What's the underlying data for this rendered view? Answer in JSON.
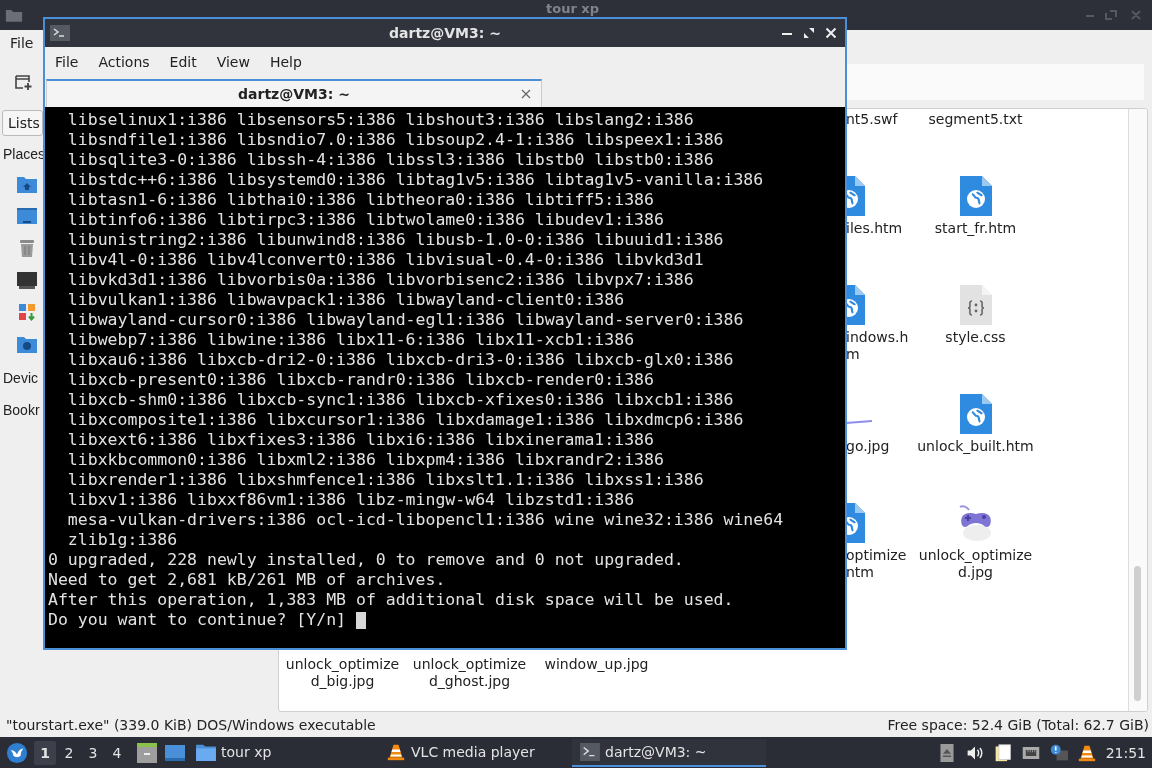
{
  "file_manager": {
    "title": "tour xp",
    "menu": [
      "File"
    ],
    "sidebar": {
      "tab": "Lists",
      "sections": [
        {
          "label": "Places",
          "items": [
            {
              "kind": "home"
            },
            {
              "kind": "desktop"
            },
            {
              "kind": "trash"
            },
            {
              "kind": "computer"
            },
            {
              "kind": "apps"
            },
            {
              "kind": "network"
            }
          ]
        },
        {
          "label": "Devic"
        },
        {
          "label": "Bookr"
        }
      ]
    },
    "files_partial": [
      {
        "label_lines": [
          "nt5.swf"
        ]
      },
      {
        "kind": "web",
        "label_lines": [
          "iles.htm"
        ]
      },
      {
        "kind": "web",
        "label_lines": [
          "indows.h",
          "m"
        ]
      },
      {
        "kind": "image",
        "label_lines": [
          "go.jpg"
        ]
      },
      {
        "kind": "web",
        "label_lines": [
          "optimize",
          "ntm"
        ]
      }
    ],
    "files_full": [
      {
        "label_lines": [
          "segment5.txt"
        ]
      },
      {
        "kind": "web",
        "label_lines": [
          "start_fr.htm"
        ]
      },
      {
        "kind": "css",
        "label_lines": [
          "style.css"
        ]
      },
      {
        "kind": "web",
        "label_lines": [
          "unlock_built.htm"
        ]
      },
      {
        "kind": "gamepad",
        "label_lines": [
          "unlock_optimize",
          "d.jpg"
        ]
      }
    ],
    "files_bottom": [
      {
        "label_lines": [
          "unlock_optimize",
          "d_big.jpg"
        ]
      },
      {
        "label_lines": [
          "unlock_optimize",
          "d_ghost.jpg"
        ]
      },
      {
        "label_lines": [
          "window_up.jpg"
        ]
      }
    ],
    "status_left": "\"tourstart.exe\" (339.0 KiB) DOS/Windows executable",
    "status_right": "Free space: 52.4 GiB (Total: 62.7 GiB)"
  },
  "terminal": {
    "title": "dartz@VM3: ~",
    "menu": [
      "File",
      "Actions",
      "Edit",
      "View",
      "Help"
    ],
    "tabs": [
      {
        "title": "dartz@VM3: ~",
        "selected": true
      }
    ],
    "lines": [
      "  libselinux1:i386 libsensors5:i386 libshout3:i386 libslang2:i386",
      "  libsndfile1:i386 libsndio7.0:i386 libsoup2.4-1:i386 libspeex1:i386",
      "  libsqlite3-0:i386 libssh-4:i386 libssl3:i386 libstb0 libstb0:i386",
      "  libstdc++6:i386 libsystemd0:i386 libtag1v5:i386 libtag1v5-vanilla:i386",
      "  libtasn1-6:i386 libthai0:i386 libtheora0:i386 libtiff5:i386",
      "  libtinfo6:i386 libtirpc3:i386 libtwolame0:i386 libudev1:i386",
      "  libunistring2:i386 libunwind8:i386 libusb-1.0-0:i386 libuuid1:i386",
      "  libv4l-0:i386 libv4lconvert0:i386 libvisual-0.4-0:i386 libvkd3d1",
      "  libvkd3d1:i386 libvorbis0a:i386 libvorbisenc2:i386 libvpx7:i386",
      "  libvulkan1:i386 libwavpack1:i386 libwayland-client0:i386",
      "  libwayland-cursor0:i386 libwayland-egl1:i386 libwayland-server0:i386",
      "  libwebp7:i386 libwine:i386 libx11-6:i386 libx11-xcb1:i386",
      "  libxau6:i386 libxcb-dri2-0:i386 libxcb-dri3-0:i386 libxcb-glx0:i386",
      "  libxcb-present0:i386 libxcb-randr0:i386 libxcb-render0:i386",
      "  libxcb-shm0:i386 libxcb-sync1:i386 libxcb-xfixes0:i386 libxcb1:i386",
      "  libxcomposite1:i386 libxcursor1:i386 libxdamage1:i386 libxdmcp6:i386",
      "  libxext6:i386 libxfixes3:i386 libxi6:i386 libxinerama1:i386",
      "  libxkbcommon0:i386 libxml2:i386 libxpm4:i386 libxrandr2:i386",
      "  libxrender1:i386 libxshmfence1:i386 libxslt1.1:i386 libxss1:i386",
      "  libxv1:i386 libxxf86vm1:i386 libz-mingw-w64 libzstd1:i386",
      "  mesa-vulkan-drivers:i386 ocl-icd-libopencl1:i386 wine wine32:i386 wine64",
      "  zlib1g:i386",
      "0 upgraded, 228 newly installed, 0 to remove and 0 not upgraded.",
      "Need to get 2,681 kB/261 MB of archives.",
      "After this operation, 1,383 MB of additional disk space will be used.",
      "Do you want to continue? [Y/n]"
    ],
    "cursor": true
  },
  "taskbar": {
    "workspaces": [
      {
        "label": "1",
        "selected": true
      },
      {
        "label": "2",
        "selected": false
      },
      {
        "label": "3",
        "selected": false
      },
      {
        "label": "4",
        "selected": false
      }
    ],
    "tasks": [
      {
        "kind": "folder",
        "label": "tour xp",
        "selected": false
      },
      {
        "kind": "vlc",
        "label": "VLC media player",
        "selected": false
      },
      {
        "kind": "terminal",
        "label": "dartz@VM3: ~",
        "selected": true
      }
    ],
    "clock": "21:51"
  }
}
